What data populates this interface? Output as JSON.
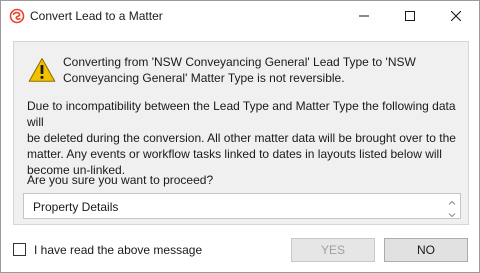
{
  "window": {
    "title": "Convert Lead to a Matter",
    "icon": "app-swirl-icon",
    "controls": {
      "minimize": "minimize-icon",
      "maximize": "maximize-icon",
      "close": "close-icon"
    }
  },
  "warning": {
    "icon": "warning-icon",
    "line1": "Converting from 'NSW Conveyancing General' Lead Type to 'NSW",
    "line2": "Conveyancing General' Matter Type is not reversible."
  },
  "info": {
    "line1": "Due to incompatibility between the Lead Type and Matter Type the following data will",
    "line2": "be deleted during the conversion. All other matter data will be brought over to the",
    "line3": "matter. Any events or workflow tasks linked to dates in layouts listed below will",
    "line4": "become un-linked."
  },
  "question": "Are you sure you want to proceed?",
  "list": {
    "items": [
      "Property Details"
    ]
  },
  "acknowledge": {
    "label": "I have read the above message",
    "checked": false
  },
  "buttons": {
    "yes": "YES",
    "no": "NO",
    "yes_enabled": false
  },
  "colors": {
    "brand": "#e8432e",
    "warning_yellow": "#f2c200",
    "panel_bg": "#f0f0f0"
  }
}
